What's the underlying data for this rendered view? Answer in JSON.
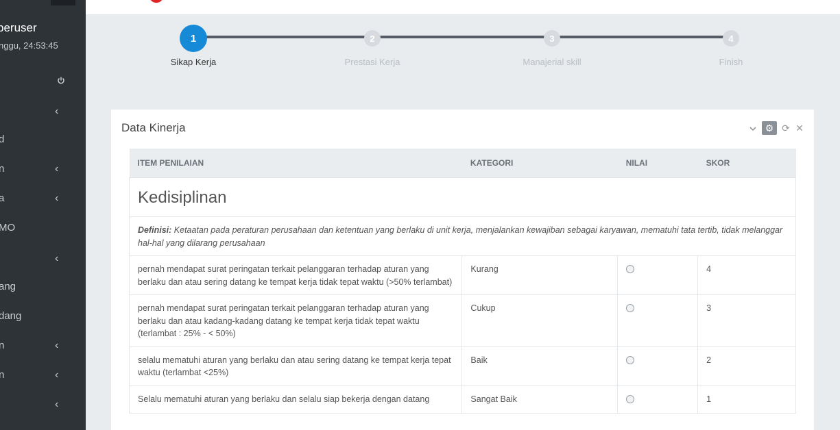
{
  "sidebar": {
    "user_name": "peruser",
    "user_time": "nggu, 24:53:45",
    "items": [
      {
        "label": "d",
        "chevron": false
      },
      {
        "label": "n",
        "chevron": true
      },
      {
        "label": "a",
        "chevron": true
      },
      {
        "label": "MO",
        "chevron": false
      },
      {
        "label": "",
        "chevron": true
      },
      {
        "label": "ang",
        "chevron": false
      },
      {
        "label": "dang",
        "chevron": false
      },
      {
        "label": "n",
        "chevron": true
      },
      {
        "label": "n",
        "chevron": true
      },
      {
        "label": "",
        "chevron": true
      }
    ]
  },
  "wizard": {
    "steps": [
      {
        "num": "1",
        "label": "Sikap Kerja",
        "active": true
      },
      {
        "num": "2",
        "label": "Prestasi Kerja",
        "active": false
      },
      {
        "num": "3",
        "label": "Manajerial skill",
        "active": false
      },
      {
        "num": "4",
        "label": "Finish",
        "active": false
      }
    ]
  },
  "panel": {
    "title": "Data Kinerja",
    "icons": [
      "chevron-down-icon",
      "gear-icon",
      "refresh-icon",
      "close-icon"
    ]
  },
  "table": {
    "headers": [
      "ITEM PENILAIAN",
      "KATEGORI",
      "NILAI",
      "SKOR"
    ],
    "section": "Kedisiplinan",
    "definition_label": "Definisi:",
    "definition_text": " Ketaatan pada peraturan perusahaan dan ketentuan yang berlaku di unit kerja, menjalankan kewajiban sebagai karyawan, mematuhi tata tertib, tidak melanggar hal-hal yang dilarang perusahaan",
    "rows": [
      {
        "item": "pernah mendapat surat peringatan terkait pelanggaran terhadap aturan yang berlaku dan atau sering datang ke tempat kerja tidak tepat waktu (>50% terlambat)",
        "kategori": "Kurang",
        "skor": "4"
      },
      {
        "item": "pernah mendapat surat peringatan terkait pelanggaran terhadap aturan yang berlaku dan atau kadang-kadang datang ke tempat kerja tidak tepat waktu (terlambat : 25% - < 50%)",
        "kategori": "Cukup",
        "skor": "3"
      },
      {
        "item": "selalu mematuhi aturan yang berlaku dan atau sering datang ke tempat kerja tepat waktu (terlambat <25%)",
        "kategori": "Baik",
        "skor": "2"
      },
      {
        "item": "Selalu mematuhi aturan yang berlaku dan selalu siap bekerja dengan datang",
        "kategori": "Sangat Baik",
        "skor": "1"
      }
    ]
  },
  "colors": {
    "accent": "#168ad6",
    "sidebar": "#2e3338"
  }
}
